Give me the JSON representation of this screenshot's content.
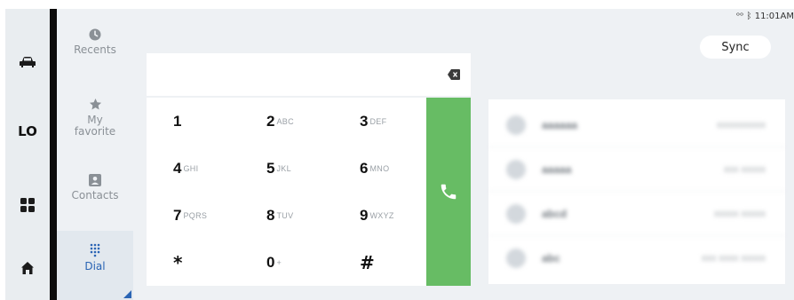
{
  "status": {
    "time": "11:01AM"
  },
  "rail": {
    "lo_label": "LO"
  },
  "menu": {
    "recents": "Recents",
    "favorite_line1": "My",
    "favorite_line2": "favorite",
    "contacts": "Contacts",
    "dial": "Dial"
  },
  "header": {
    "sync_label": "Sync"
  },
  "keypad": {
    "keys": [
      {
        "digit": "1",
        "letters": ""
      },
      {
        "digit": "2",
        "letters": "ABC"
      },
      {
        "digit": "3",
        "letters": "DEF"
      },
      {
        "digit": "4",
        "letters": "GHI"
      },
      {
        "digit": "5",
        "letters": "JKL"
      },
      {
        "digit": "6",
        "letters": "MNO"
      },
      {
        "digit": "7",
        "letters": "PQRS"
      },
      {
        "digit": "8",
        "letters": "TUV"
      },
      {
        "digit": "9",
        "letters": "WXYZ"
      },
      {
        "digit": "*",
        "letters": ""
      },
      {
        "digit": "0",
        "letters": "+"
      },
      {
        "digit": "#",
        "letters": ""
      }
    ]
  },
  "suggestions": [
    {
      "name": "aaaaaa",
      "number": "xxxxxxxxxx"
    },
    {
      "name": "aaaaa",
      "number": "xxx xxxxx"
    },
    {
      "name": "abcd",
      "number": "xxxxx xxxxx"
    },
    {
      "name": "abc",
      "number": "xxx xxxx xxxxx"
    }
  ],
  "colors": {
    "accent_blue": "#2a64b4",
    "call_green": "#67bc64"
  }
}
